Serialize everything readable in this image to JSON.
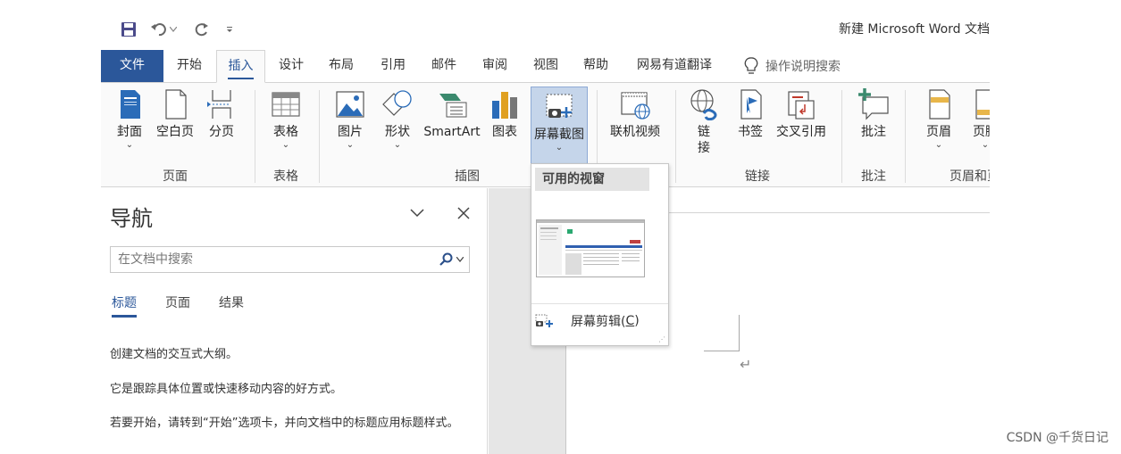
{
  "titlebar": {
    "doc_title": "新建 Microsoft Word 文档",
    "qat": {
      "save_icon": "save-icon",
      "undo_icon": "undo-icon",
      "redo_icon": "redo-icon",
      "customize_icon": "customize-qat-icon"
    }
  },
  "tabs": [
    "文件",
    "开始",
    "插入",
    "设计",
    "布局",
    "引用",
    "邮件",
    "审阅",
    "视图",
    "帮助",
    "网易有道翻译"
  ],
  "active_tab": "插入",
  "tell_me": "操作说明搜索",
  "ribbon": {
    "buttons": {
      "cover": "封面",
      "blank_page": "空白页",
      "page_break": "分页",
      "table": "表格",
      "picture": "图片",
      "shapes": "形状",
      "smartart": "SmartArt",
      "chart": "图表",
      "screenshot": "屏幕截图",
      "online_video": "联机视频",
      "link_line1": "链",
      "link_line2": "接",
      "bookmark": "书签",
      "cross_ref": "交叉引用",
      "comment": "批注",
      "header": "页眉",
      "footer": "页脚"
    },
    "groups": {
      "pages": "页面",
      "tables": "表格",
      "illustrations": "插图",
      "links": "链接",
      "comments": "批注",
      "header_footer": "页眉和页脚"
    },
    "caret": "⌄"
  },
  "screenshot_dropdown": {
    "header": "可用的视窗",
    "clip_item": "屏幕剪辑(",
    "clip_key": "C",
    "clip_item_end": ")"
  },
  "navpane": {
    "title": "导航",
    "search_placeholder": "在文档中搜索",
    "tabs": [
      "标题",
      "页面",
      "结果"
    ],
    "active_tab": "标题",
    "text1": "创建文档的交互式大纲。",
    "text2": "它是跟踪具体位置或快速移动内容的好方式。",
    "text3": "若要开始，请转到“开始”选项卡，并向文档中的标题应用标题样式。"
  },
  "document": {
    "para_mark": "↵"
  },
  "watermark": "CSDN @千货日记",
  "colors": {
    "accent": "#2b579a",
    "pressed": "#c5d5ea",
    "ribbon_bg": "#fafafa"
  }
}
